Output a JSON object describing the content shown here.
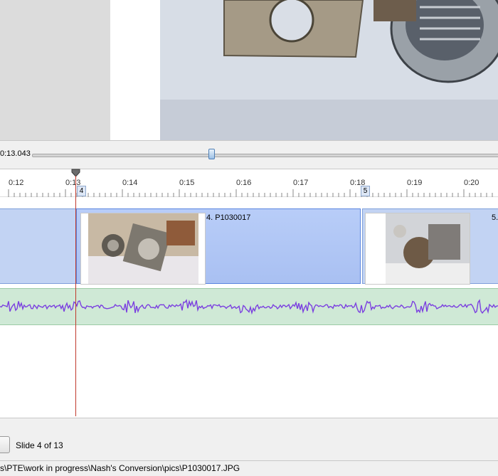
{
  "preview": {
    "image_alt": "Preview of current slide photo"
  },
  "scrubber": {
    "time": "0:13.043",
    "position_fraction": 0.385
  },
  "ruler": {
    "ticks": [
      "0:12",
      "0:13",
      "0:14",
      "0:15",
      "0:16",
      "0:17",
      "0:18",
      "0:19",
      "0:20"
    ],
    "markers": [
      "4",
      "5"
    ]
  },
  "slides": [
    {
      "number": "4",
      "label": "4. P1030017"
    },
    {
      "number": "5",
      "label": "5."
    }
  ],
  "footer": {
    "slide_counter": "Slide 4 of 13"
  },
  "status": {
    "path": "s\\PTE\\work in progress\\Nash's Conversion\\pics\\P1030017.JPG"
  },
  "colors": {
    "audio_wave": "#7b3fe0",
    "playhead": "#c0392b",
    "selected_slide": "#b3c8f5"
  }
}
